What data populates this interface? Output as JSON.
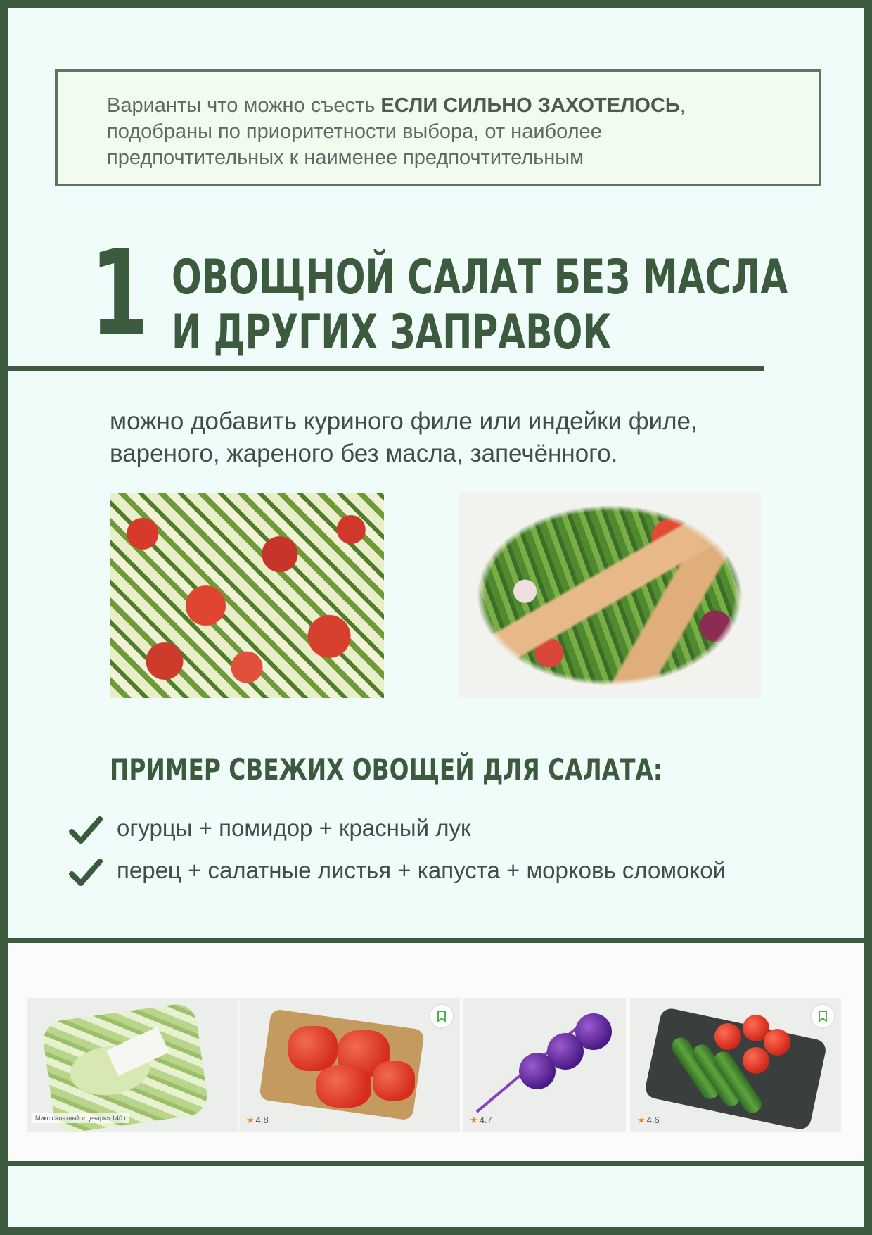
{
  "intro": {
    "line1_prefix": "Варианты что можно съесть ",
    "line1_bold": "ЕСЛИ СИЛЬНО ЗАХОТЕЛОСЬ",
    "line1_suffix": ",",
    "line2": "подобраны по приоритетности выбора, от наиболее",
    "line3": "предпочтительных к наименее предпочтительным"
  },
  "section": {
    "number": "1",
    "title_line1": "ОВОЩНОЙ САЛАТ БЕЗ МАСЛА",
    "title_line2": "И ДРУГИХ ЗАПРАВОК",
    "note_line1": "можно добавить куриного филе или индейки филе,",
    "note_line2": "вареного, жареного без масла, запечённого."
  },
  "examples": {
    "title": "ПРИМЕР СВЕЖИХ ОВОЩЕЙ ДЛЯ САЛАТА:",
    "items": [
      "огурцы + помидор + красный лук",
      "перец + салатные листья + капуста + морковь сломокой"
    ]
  },
  "products": [
    {
      "caption": "Микс салатный «Цезарь» 140 г",
      "rating": ""
    },
    {
      "caption": "",
      "rating": "4.8"
    },
    {
      "caption": "",
      "rating": "4.7"
    },
    {
      "caption": "",
      "rating": "4.6"
    }
  ],
  "colors": {
    "frame": "#3d5a3e",
    "page_bg": "#effcf9",
    "heading": "#3b5a3e",
    "intro_bg": "#f1fcee",
    "rating_star": "#e58a2b"
  },
  "icons": {
    "check": "check-icon",
    "bookmark": "bookmark-icon",
    "star": "star-icon"
  }
}
